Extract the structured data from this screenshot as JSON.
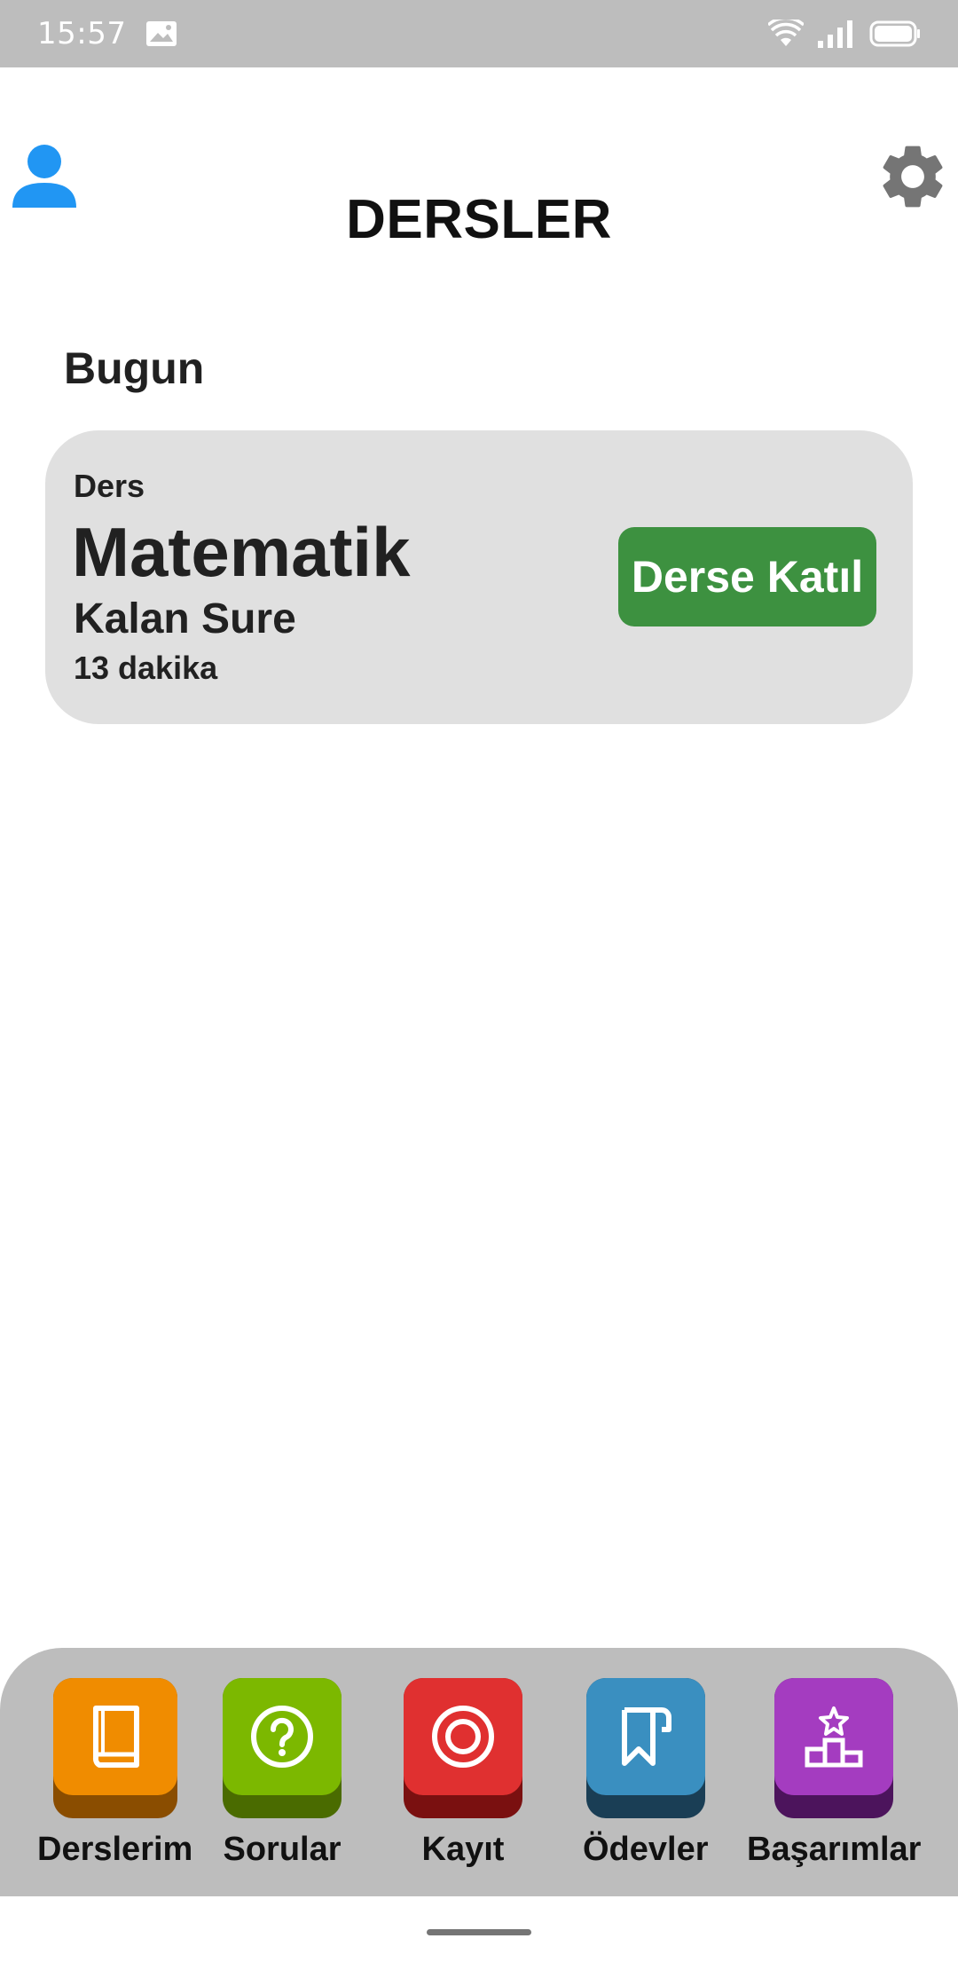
{
  "status_bar": {
    "time": "15:57",
    "icons": [
      "image-notification-icon",
      "wifi-icon",
      "signal-icon",
      "battery-icon"
    ]
  },
  "header": {
    "title": "DERSLER",
    "profile_icon": "person-icon",
    "settings_icon": "gear-icon",
    "accent_color": "#2196f3"
  },
  "section": {
    "title": "Bugun"
  },
  "lesson_card": {
    "caption": "Ders",
    "subject": "Matematik",
    "remaining_label": "Kalan Sure",
    "remaining_value": "13 dakika",
    "join_label": "Derse Katıl",
    "join_color": "#3d9140"
  },
  "bottom_nav": {
    "items": [
      {
        "label": "Derslerim",
        "icon": "book-icon",
        "color": "#f08c00",
        "shade": "#8a4d00"
      },
      {
        "label": "Sorular",
        "icon": "question-icon",
        "color": "#7cb800",
        "shade": "#4a6b00"
      },
      {
        "label": "Kayıt",
        "icon": "target-icon",
        "color": "#e03030",
        "shade": "#7a1010"
      },
      {
        "label": "Ödevler",
        "icon": "bookmark-page-icon",
        "color": "#3a8fc0",
        "shade": "#1a3e55"
      },
      {
        "label": "Başarımlar",
        "icon": "podium-star-icon",
        "color": "#a43cc0",
        "shade": "#4c145c"
      }
    ]
  }
}
